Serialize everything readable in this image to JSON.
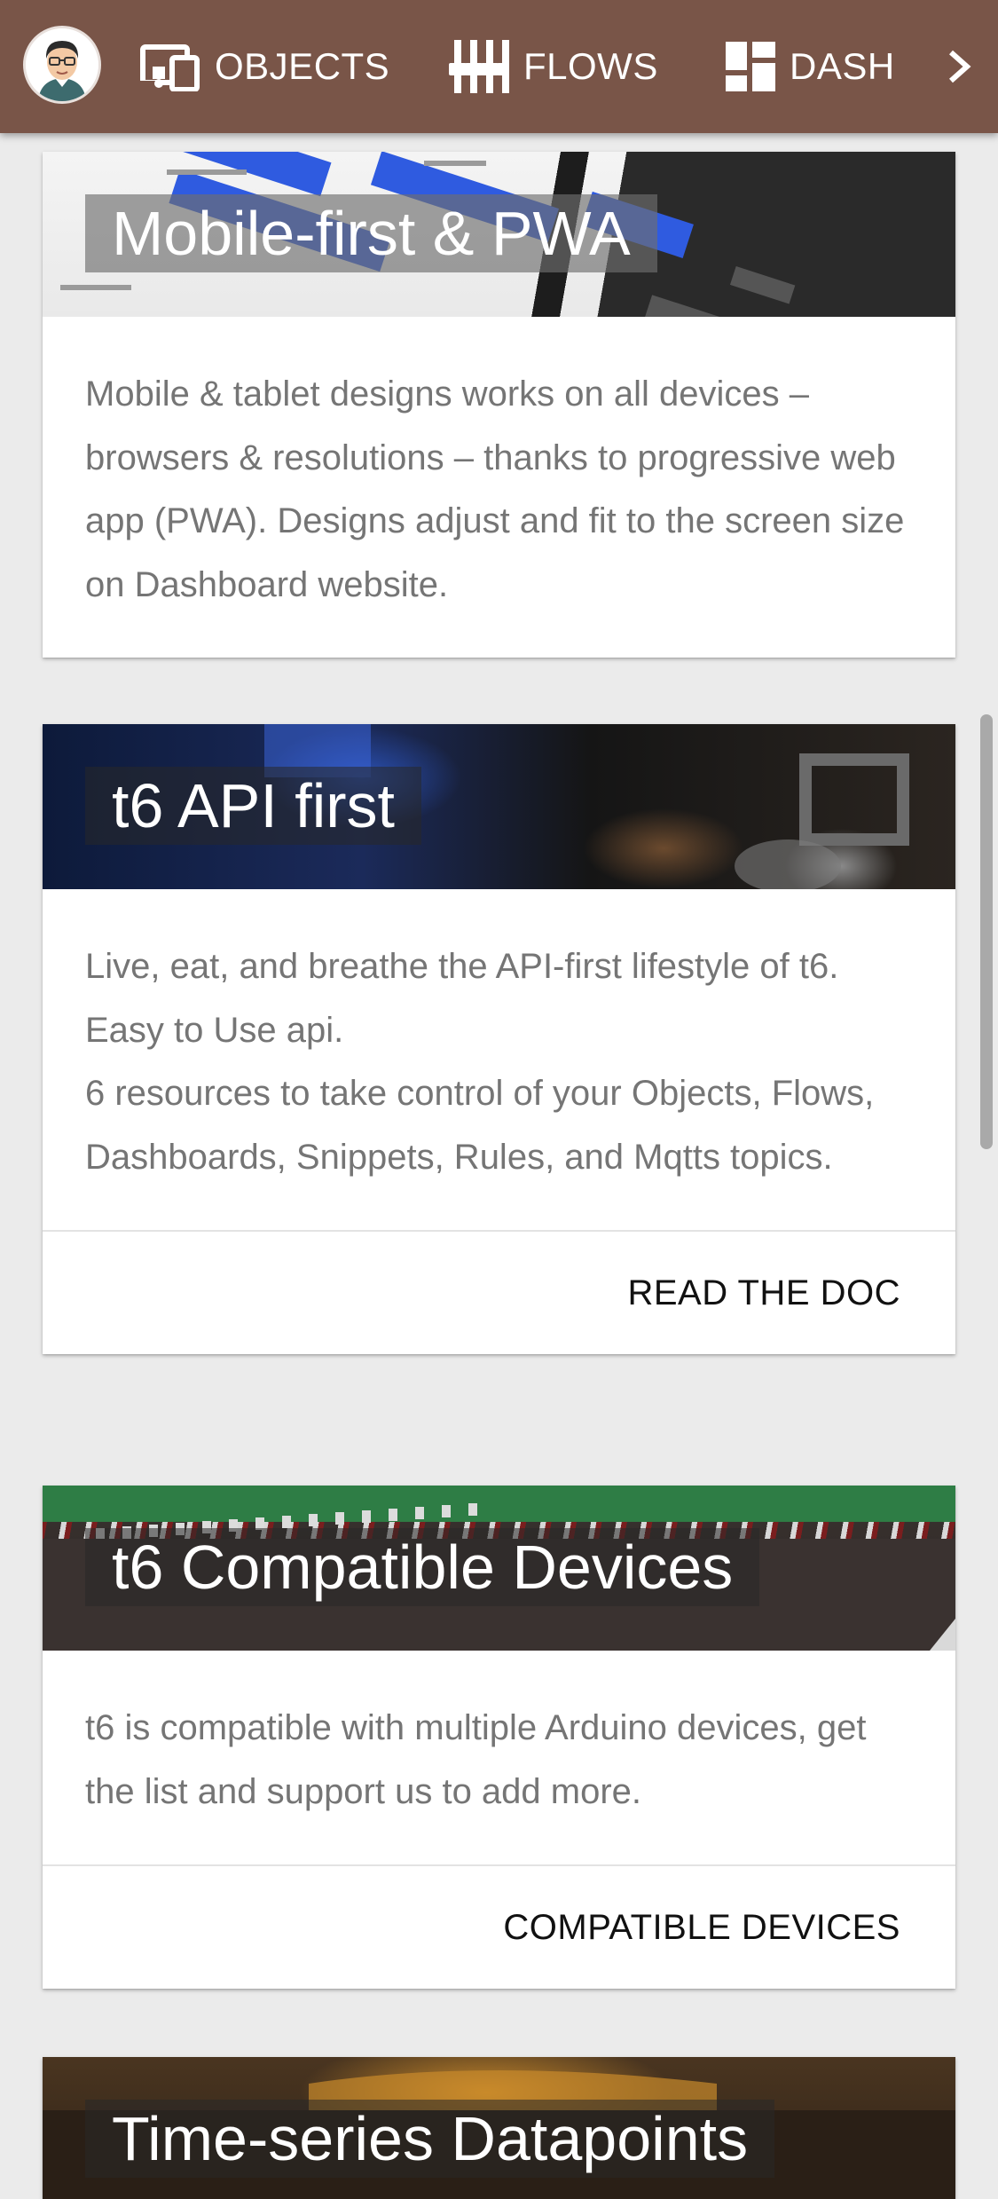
{
  "nav": {
    "items": [
      {
        "label": "OBJECTS",
        "icon": "devices-icon"
      },
      {
        "label": "FLOWS",
        "icon": "tune-sliders-icon"
      },
      {
        "label": "DASH",
        "icon": "dashboard-icon"
      }
    ],
    "next_icon": "chevron-right-icon",
    "avatar_icon": "user-avatar",
    "bar_color": "#795548"
  },
  "cards": [
    {
      "title": "Mobile-first & PWA",
      "text": [
        "Mobile & tablet designs works on all devices – browsers & resolutions – thanks to progressive web app (PWA). Designs adjust and fit to the screen size on Dashboard website."
      ]
    },
    {
      "title": "t6 API first",
      "text": [
        "Live, eat, and breathe the API-first lifestyle of t6.",
        "Easy to Use api.",
        "6 resources to take control of your Objects, Flows, Dashboards, Snippets, Rules, and Mqtts topics."
      ],
      "action": "READ THE DOC"
    },
    {
      "title": "t6 Compatible Devices",
      "text": [
        "t6 is compatible with multiple Arduino devices, get the list and support us to add more."
      ],
      "action": "COMPATIBLE DEVICES"
    },
    {
      "title": "Time-series Datapoints"
    }
  ]
}
